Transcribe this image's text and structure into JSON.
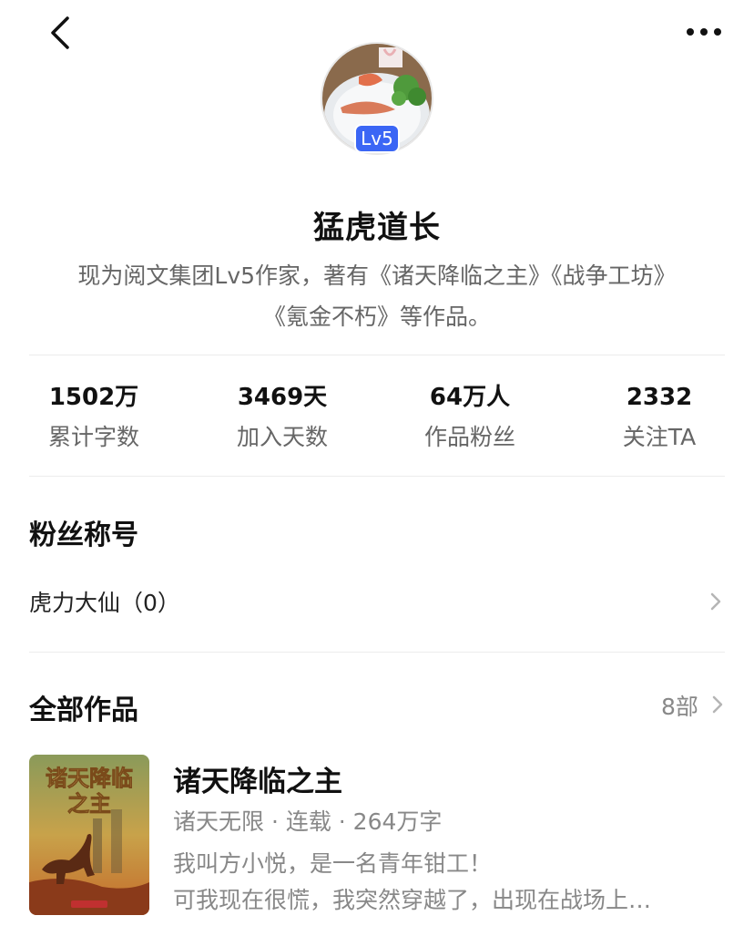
{
  "author": {
    "name": "猛虎道长",
    "level_badge": "Lv5",
    "bio_line1": "现为阅文集团Lv5作家，著有《诸天降临之主》《战争工坊》",
    "bio_line2": "《氪金不朽》等作品。"
  },
  "stats": [
    {
      "value": "1502万",
      "label": "累计字数"
    },
    {
      "value": "3469天",
      "label": "加入天数"
    },
    {
      "value": "64万人",
      "label": "作品粉丝"
    },
    {
      "value": "2332",
      "label": "关注TA"
    }
  ],
  "fan_title": {
    "heading": "粉丝称号",
    "item": "虎力大仙（0）"
  },
  "works": {
    "heading": "全部作品",
    "count": "8部",
    "books": [
      {
        "title": "诸天降临之主",
        "meta": "诸天无限 · 连载 · 264万字",
        "desc_line1": "我叫方小悦，是一名青年钳工！",
        "desc_line2": "可我现在很慌，我突然穿越了，出现在战场上…",
        "cover_text": "诸天降临之主"
      }
    ]
  },
  "icons": {
    "back": "chevron-left-icon",
    "more": "more-dots-icon",
    "arrow": "chevron-right-icon"
  },
  "colors": {
    "badge": "#3b66f5",
    "secondary_text": "#666666"
  }
}
